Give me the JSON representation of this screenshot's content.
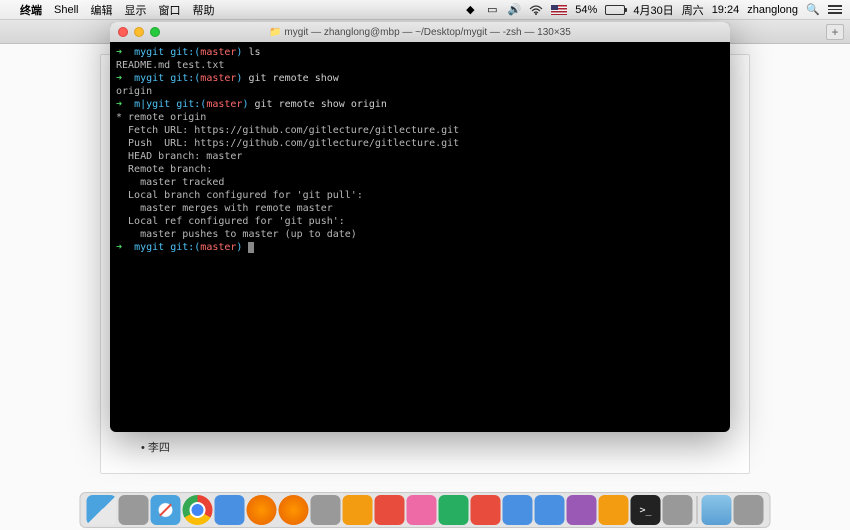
{
  "menubar": {
    "app": "终端",
    "items": [
      "Shell",
      "编辑",
      "显示",
      "窗口",
      "帮助"
    ],
    "battery_pct": "54%",
    "date": "4月30日",
    "day": "周六",
    "time": "19:24",
    "user": "zhanglong"
  },
  "bg_window": {
    "list_bullet": "•",
    "list_item": "李四"
  },
  "terminal": {
    "title": "mygit — zhanglong@mbp — ~/Desktop/mygit — -zsh — 130×35",
    "lines": [
      {
        "type": "prompt",
        "arrow": "➜",
        "dir": "mygit",
        "git": "git:(",
        "branch": "master",
        "gitc": ")",
        "cmd": "ls"
      },
      {
        "type": "out",
        "text": "README.md test.txt"
      },
      {
        "type": "prompt",
        "arrow": "➜",
        "dir": "mygit",
        "git": "git:(",
        "branch": "master",
        "gitc": ")",
        "cmd": "git remote show"
      },
      {
        "type": "out",
        "text": "origin"
      },
      {
        "type": "prompt",
        "arrow": "➜",
        "dir": "m|ygit",
        "git": "git:(",
        "branch": "master",
        "gitc": ")",
        "cmd": "git remote show origin"
      },
      {
        "type": "out",
        "text": "* remote origin"
      },
      {
        "type": "out",
        "text": "  Fetch URL: https://github.com/gitlecture/gitlecture.git"
      },
      {
        "type": "out",
        "text": "  Push  URL: https://github.com/gitlecture/gitlecture.git"
      },
      {
        "type": "out",
        "text": "  HEAD branch: master"
      },
      {
        "type": "out",
        "text": "  Remote branch:"
      },
      {
        "type": "out",
        "text": "    master tracked"
      },
      {
        "type": "out",
        "text": "  Local branch configured for 'git pull':"
      },
      {
        "type": "out",
        "text": "    master merges with remote master"
      },
      {
        "type": "out",
        "text": "  Local ref configured for 'git push':"
      },
      {
        "type": "out",
        "text": "    master pushes to master (up to date)"
      },
      {
        "type": "prompt",
        "arrow": "➜",
        "dir": "mygit",
        "git": "git:(",
        "branch": "master",
        "gitc": ")",
        "cmd": "",
        "cursor": true
      }
    ]
  },
  "dock": {
    "items": [
      {
        "name": "finder",
        "cls": "di-finder"
      },
      {
        "name": "launchpad",
        "cls": "di-gray"
      },
      {
        "name": "safari",
        "cls": "di-safari"
      },
      {
        "name": "chrome",
        "cls": "di-chrome"
      },
      {
        "name": "app-store",
        "cls": "di-blue"
      },
      {
        "name": "firefox",
        "cls": "di-firefox"
      },
      {
        "name": "firefox-dev",
        "cls": "di-firefox"
      },
      {
        "name": "mail",
        "cls": "di-gray"
      },
      {
        "name": "notes",
        "cls": "di-orange"
      },
      {
        "name": "calendar",
        "cls": "di-red"
      },
      {
        "name": "music",
        "cls": "di-pink"
      },
      {
        "name": "wechat",
        "cls": "di-green"
      },
      {
        "name": "qq",
        "cls": "di-red"
      },
      {
        "name": "skype",
        "cls": "di-blue"
      },
      {
        "name": "vscode",
        "cls": "di-blue"
      },
      {
        "name": "intellij",
        "cls": "di-purple"
      },
      {
        "name": "sublime",
        "cls": "di-orange"
      },
      {
        "name": "terminal",
        "cls": "di-terminal"
      },
      {
        "name": "preferences",
        "cls": "di-gray"
      },
      {
        "name": "sep"
      },
      {
        "name": "folder",
        "cls": "di-folder"
      },
      {
        "name": "trash",
        "cls": "di-gray"
      }
    ]
  }
}
